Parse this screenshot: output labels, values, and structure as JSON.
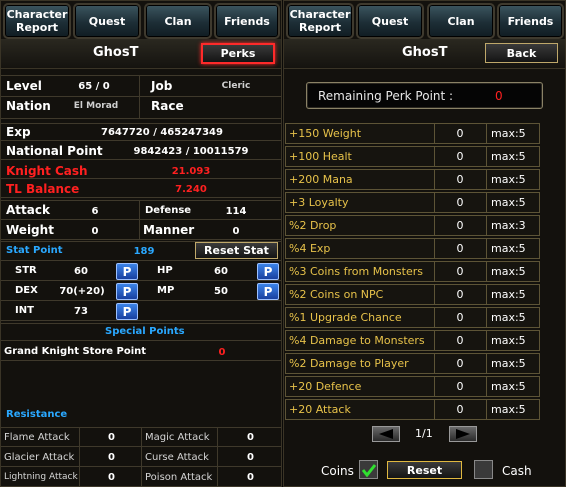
{
  "left": {
    "tabs": [
      "Character\nReport",
      "Quest",
      "Clan",
      "Friends"
    ],
    "name": "GhosT",
    "perks_button": "Perks",
    "level_label": "Level",
    "level_value": "65 / 0",
    "job_label": "Job",
    "job_value": "Cleric",
    "nation_label": "Nation",
    "nation_value": "El Morad",
    "race_label": "Race",
    "race_value": "",
    "exp_label": "Exp",
    "exp_value": "7647720 / 465247349",
    "np_label": "National Point",
    "np_value": "9842423 / 10011579",
    "kc_label": "Knight Cash",
    "kc_value": "21.093",
    "tl_label": "TL Balance",
    "tl_value": "7.240",
    "attack_label": "Attack",
    "attack_value": "6",
    "defense_label": "Defense",
    "defense_value": "114",
    "weight_label": "Weight",
    "weight_value": "0",
    "manner_label": "Manner",
    "manner_value": "0",
    "stat_point_label": "Stat Point",
    "stat_point_value": "189",
    "reset_stat_button": "Reset Stat",
    "str_label": "STR",
    "str_value": "60",
    "hp_label": "HP",
    "hp_value": "60",
    "dex_label": "DEX",
    "dex_value": "70(+20)",
    "mp_label": "MP",
    "mp_value": "50",
    "int_label": "INT",
    "int_value": "73",
    "p_button": "P",
    "special_points_title": "Special Points",
    "gk_store_label": "Grand Knight Store Point",
    "gk_store_value": "0",
    "resistance_title": "Resistance",
    "flame_label": "Flame Attack",
    "flame_value": "0",
    "magic_label": "Magic Attack",
    "magic_value": "0",
    "glacier_label": "Glacier Attack",
    "glacier_value": "0",
    "curse_label": "Curse Attack",
    "curse_value": "0",
    "lightning_label": "Lightning Attack",
    "lightning_value": "0",
    "poison_label": "Poison Attack",
    "poison_value": "0"
  },
  "right": {
    "tabs": [
      "Character\nReport",
      "Quest",
      "Clan",
      "Friends"
    ],
    "name": "GhosT",
    "back_button": "Back",
    "remaining_label": "Remaining Perk Point :",
    "remaining_value": "0",
    "perks": [
      {
        "name": "+150 Weight",
        "value": "0",
        "max": "max:5"
      },
      {
        "name": "+100 Healt",
        "value": "0",
        "max": "max:5"
      },
      {
        "name": "+200 Mana",
        "value": "0",
        "max": "max:5"
      },
      {
        "name": "+3 Loyalty",
        "value": "0",
        "max": "max:5"
      },
      {
        "name": "%2 Drop",
        "value": "0",
        "max": "max:3"
      },
      {
        "name": "%4 Exp",
        "value": "0",
        "max": "max:5"
      },
      {
        "name": "%3 Coins from Monsters",
        "value": "0",
        "max": "max:5"
      },
      {
        "name": "%2 Coins on NPC",
        "value": "0",
        "max": "max:5"
      },
      {
        "name": "%1 Upgrade Chance",
        "value": "0",
        "max": "max:5"
      },
      {
        "name": "%4 Damage to Monsters",
        "value": "0",
        "max": "max:5"
      },
      {
        "name": "%2 Damage to Player",
        "value": "0",
        "max": "max:5"
      },
      {
        "name": "+20 Defence",
        "value": "0",
        "max": "max:5"
      },
      {
        "name": "+20 Attack",
        "value": "0",
        "max": "max:5"
      }
    ],
    "page": "1/1",
    "coins_label": "Coins",
    "coins_checked": true,
    "reset_button": "Reset",
    "cash_label": "Cash",
    "cash_checked": false
  },
  "colors": {
    "accent_red": "#ff2020",
    "accent_blue": "#2aa8ff",
    "perk_text": "#e7c24a"
  }
}
